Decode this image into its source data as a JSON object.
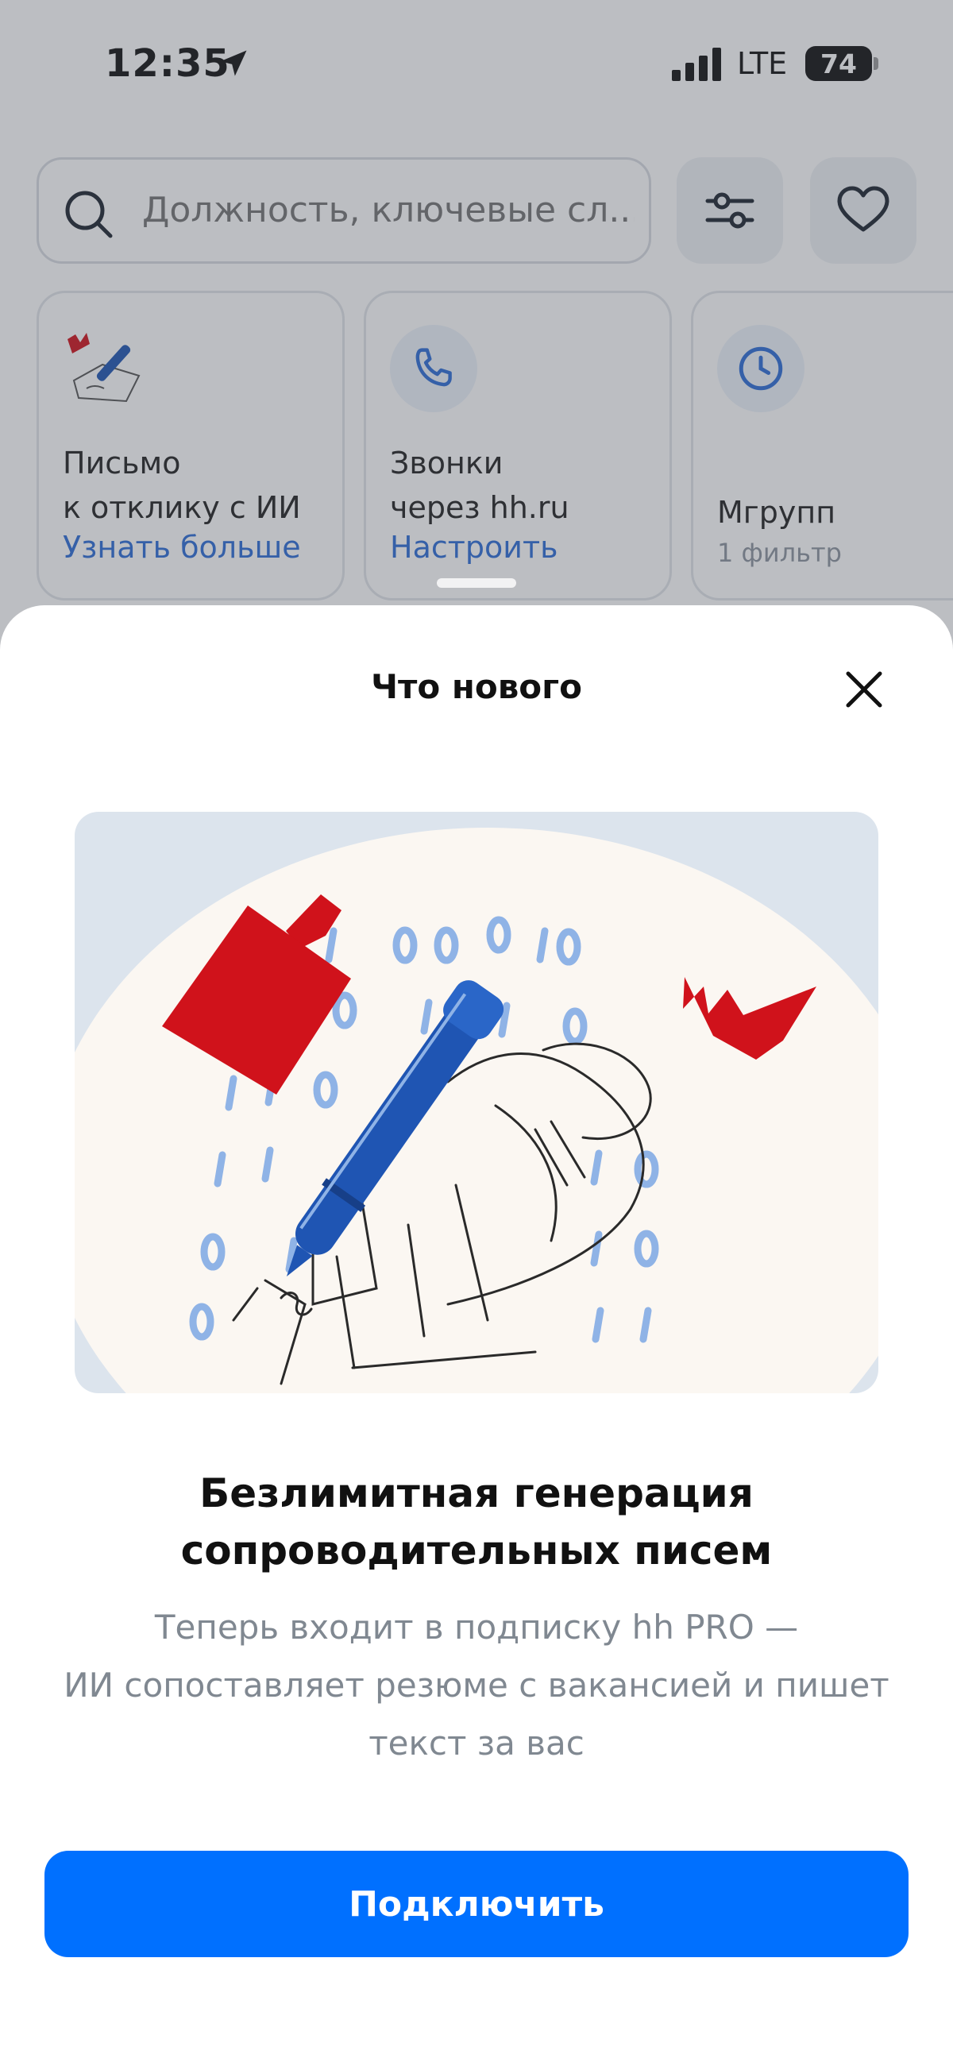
{
  "status_bar": {
    "time": "12:35",
    "network": "LTE",
    "battery": "74",
    "location_icon": "location-arrow-icon",
    "signal_icon": "signal-bars-icon"
  },
  "search": {
    "placeholder": "Должность, ключевые сл...",
    "icon": "search-icon",
    "filter_icon": "sliders-icon",
    "favorites_icon": "heart-icon"
  },
  "cards": [
    {
      "title": "Письмо\nк отклику с ИИ",
      "link": "Узнать больше",
      "icon": "pen-letter-icon"
    },
    {
      "title": "Звонки\nчерез hh.ru",
      "link": "Настроить",
      "icon": "phone-icon"
    },
    {
      "title": "Мгрупп",
      "subtitle": "1 фильтр",
      "icon": "clock-icon"
    }
  ],
  "sheet": {
    "title": "Что нового",
    "close_icon": "close-icon",
    "headline": [
      "Безлимитная генерация",
      "сопроводительных писем"
    ],
    "description": [
      "Теперь входит в подписку hh PRO —",
      "ИИ сопоставляет резюме с вакансией и пишет",
      "текст за вас"
    ],
    "button_label": "Подключить",
    "illustration": {
      "digits": "1 1 0 0 0 1 0 / 0 1 1 1 0 / 1 1 0 0 1 1 0 / 1 1 0 1 1 0 / 0 1 1 0 1 0 / 0 1 1 1"
    }
  },
  "colors": {
    "accent": "#0070ff",
    "link": "#2d6dd6",
    "illustration_red": "#d0121b",
    "illustration_blue": "#1f55b3"
  }
}
